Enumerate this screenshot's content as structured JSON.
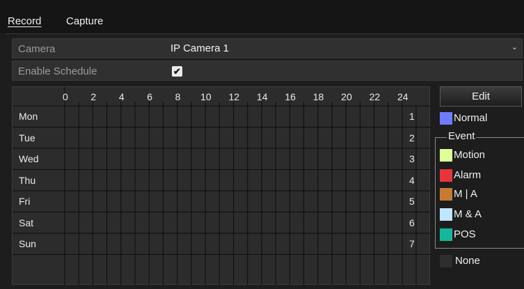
{
  "tabs": [
    {
      "label": "Record",
      "active": true
    },
    {
      "label": "Capture",
      "active": false
    }
  ],
  "camera": {
    "label": "Camera",
    "value": "IP Camera 1",
    "chevron": "chevron-down-icon"
  },
  "schedule": {
    "label": "Enable Schedule",
    "checked": true,
    "check_glyph": "✔"
  },
  "grid": {
    "hours": [
      "0",
      "2",
      "4",
      "6",
      "8",
      "10",
      "12",
      "14",
      "16",
      "18",
      "20",
      "22",
      "24"
    ],
    "days": [
      {
        "name": "Mon",
        "num": "1"
      },
      {
        "name": "Tue",
        "num": "2"
      },
      {
        "name": "Wed",
        "num": "3"
      },
      {
        "name": "Thu",
        "num": "4"
      },
      {
        "name": "Fri",
        "num": "5"
      },
      {
        "name": "Sat",
        "num": "6"
      },
      {
        "name": "Sun",
        "num": "7"
      }
    ]
  },
  "edit_label": "Edit",
  "legend": {
    "normal": {
      "label": "Normal",
      "color": "#6f7cff"
    },
    "event_title": "Event",
    "events": [
      {
        "label": "Motion",
        "color": "#ddff99"
      },
      {
        "label": "Alarm",
        "color": "#e8353b"
      },
      {
        "label": "M | A",
        "color": "#c87a34"
      },
      {
        "label": "M & A",
        "color": "#bfe5ff"
      },
      {
        "label": "POS",
        "color": "#14b79c"
      }
    ],
    "none": {
      "label": "None",
      "color": "#2e2e2e"
    }
  }
}
